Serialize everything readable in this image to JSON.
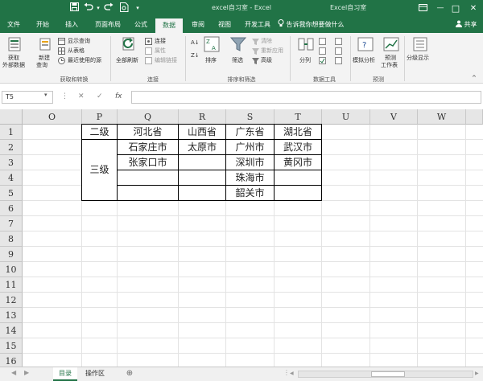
{
  "titlebar": {
    "save_icon": "save-icon",
    "undo_icon": "undo-icon",
    "redo_icon": "redo-icon",
    "preview_icon": "print-preview-icon",
    "customize_icon": "customize-arrow-icon",
    "doc_title": "excel自习室 - Excel",
    "right_text": "Excel自习室",
    "user_icon": "user-icon",
    "ribbon_opt_icon": "ribbon-options-icon",
    "min_glyph": "—",
    "max_glyph": "□",
    "close_glyph": "✕"
  },
  "tabs": [
    "文件",
    "开始",
    "插入",
    "页面布局",
    "公式",
    "数据",
    "审阅",
    "视图",
    "开发工具"
  ],
  "active_tab": "数据",
  "tell_me": "告诉我你想要做什么",
  "share": "共享",
  "ribbon": {
    "get_external": [
      "获取",
      "外部数据"
    ],
    "new_query": [
      "新建",
      "查询"
    ],
    "show_query": "显示查询",
    "from_table": "从表格",
    "recent_sources": "最近使用的源",
    "group_get_transform": "获取和转换",
    "refresh_all": "全部刷新",
    "connections": "连接",
    "properties": "属性",
    "edit_links": "编辑链接",
    "group_connections": "连接",
    "sort": "排序",
    "filter": "筛选",
    "clear": "清除",
    "reapply": "重新应用",
    "advanced": "高级",
    "group_sort_filter": "排序和筛选",
    "text_to_columns": "分列",
    "group_data_tools": "数据工具",
    "what_if": "模拟分析",
    "forecast_sheet": [
      "预测",
      "工作表"
    ],
    "group_forecast": "预测",
    "outline": "分级显示"
  },
  "formula_bar": {
    "name_box": "T5",
    "cancel": "✕",
    "enter": "✓",
    "fx": "fx",
    "value": ""
  },
  "columns": [
    "O",
    "P",
    "Q",
    "R",
    "S",
    "T",
    "U",
    "V",
    "W"
  ],
  "rows": [
    "1",
    "2",
    "3",
    "4",
    "5",
    "6",
    "7",
    "8",
    "9",
    "10",
    "11",
    "12",
    "13",
    "14",
    "15",
    "16"
  ],
  "cells": {
    "P1": "二级",
    "P_merged_2_5": "三级",
    "Q1": "河北省",
    "R1": "山西省",
    "S1": "广东省",
    "T1": "湖北省",
    "Q2": "石家庄市",
    "R2": "太原市",
    "S2": "广州市",
    "T2": "武汉市",
    "Q3": "张家口市",
    "S3": "深圳市",
    "T3": "黄冈市",
    "S4": "珠海市",
    "S5": "韶关市"
  },
  "sheets": [
    "目录",
    "操作区"
  ],
  "active_sheet": "目录",
  "add_sheet": "⊕",
  "colors": {
    "excel_green": "#217346",
    "ribbon_bg": "#f3f3f3",
    "header_bg": "#e6e6e6"
  }
}
